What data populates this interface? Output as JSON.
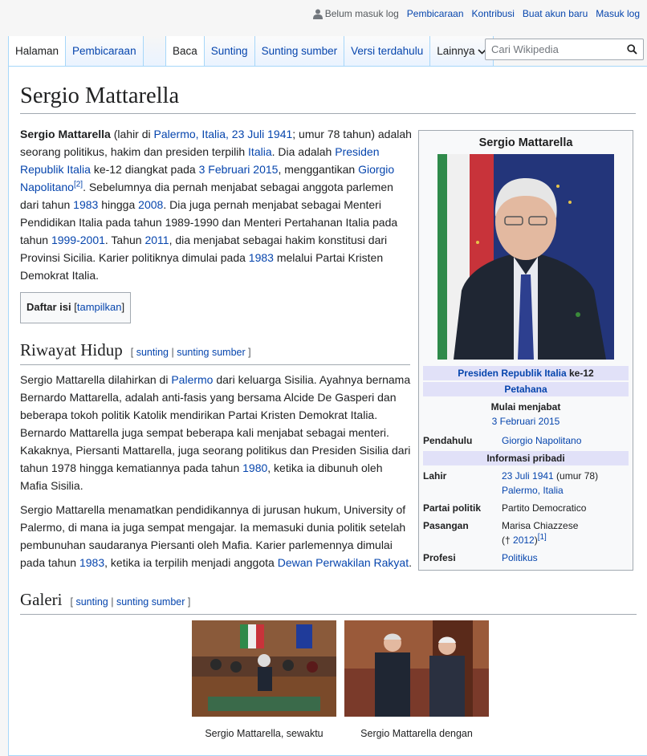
{
  "personal": {
    "anon": "Belum masuk log",
    "talk": "Pembicaraan",
    "contrib": "Kontribusi",
    "create": "Buat akun baru",
    "login": "Masuk log"
  },
  "tabs_left": [
    "Halaman",
    "Pembicaraan"
  ],
  "tabs_right": {
    "read": "Baca",
    "edit": "Sunting",
    "editsrc": "Sunting sumber",
    "history": "Versi terdahulu",
    "more": "Lainnya"
  },
  "search": {
    "placeholder": "Cari Wikipedia"
  },
  "title": "Sergio Mattarella",
  "intro": {
    "name": "Sergio Mattarella",
    "t1": " (lahir di ",
    "l_palermo": "Palermo, Italia, 23 Juli 1941",
    "t2": "; umur 78 tahun) adalah seorang politikus, hakim dan presiden terpilih ",
    "l_italia": "Italia",
    "t3": ". Dia adalah ",
    "l_presiden": "Presiden Republik Italia",
    "t4": " ke-12 diangkat pada ",
    "l_date": "3 Februari 2015",
    "t5": ", menggantikan ",
    "l_giorgio": "Giorgio Napolitano",
    "ref": "[2]",
    "t6": ". Sebelumnya dia pernah menjabat sebagai anggota parlemen dari tahun ",
    "l_1983": "1983",
    "t7": " hingga ",
    "l_2008": "2008",
    "t8": ". Dia juga pernah menjabat sebagai Menteri Pendidikan Italia pada tahun 1989-1990 dan Menteri Pertahanan Italia pada tahun ",
    "l_1999": "1999-2001",
    "t9": ". Tahun ",
    "l_2011": "2011",
    "t10": ", dia menjabat sebagai hakim konstitusi dari Provinsi Sicilia. Karier politiknya dimulai pada ",
    "l_1983b": "1983",
    "t11": " melalui Partai Kristen Demokrat Italia."
  },
  "toc": {
    "title": "Daftar isi",
    "open": " [",
    "show": "tampilkan",
    "close": "]"
  },
  "edit": {
    "open": "[ ",
    "sunting": "sunting",
    "sep": " | ",
    "sumber": "sunting sumber",
    "close": " ]"
  },
  "riwayat": {
    "heading": "Riwayat Hidup",
    "p1a": "Sergio Mattarella dilahirkan di ",
    "p1_palermo": "Palermo",
    "p1b": " dari keluarga Sisilia. Ayahnya bernama Bernardo Mattarella, adalah anti-fasis yang bersama Alcide De Gasperi dan beberapa tokoh politik Katolik mendirikan Partai Kristen Demokrat Italia. Bernardo Mattarella juga sempat beberapa kali menjabat sebagai menteri. Kakaknya, Piersanti Mattarella, juga seorang politikus dan Presiden Sisilia dari tahun 1978 hingga kematiannya pada tahun ",
    "p1_1980": "1980",
    "p1c": ", ketika ia dibunuh oleh Mafia Sisilia.",
    "p2a": "Sergio Mattarella menamatkan pendidikannya di jurusan hukum, University of Palermo, di mana ia juga sempat mengajar. Ia memasuki dunia politik setelah pembunuhan saudaranya Piersanti oleh Mafia. Karier parlemennya dimulai pada tahun ",
    "p2_1983": "1983",
    "p2b": ", ketika ia terpilih menjadi anggota ",
    "p2_dpr": "Dewan Perwakilan Rakyat",
    "p2c": "."
  },
  "galeri": {
    "heading": "Galeri",
    "cap1": "Sergio Mattarella, sewaktu",
    "cap2": "Sergio Mattarella dengan"
  },
  "infobox": {
    "title": "Sergio Mattarella",
    "office": "Presiden Republik Italia",
    "office_suffix": " ke-12",
    "incumbent": "Petahana",
    "start_label": "Mulai menjabat",
    "start_date": "3 Februari 2015",
    "pred_label": "Pendahulu",
    "pred": "Giorgio Napolitano",
    "personal_head": "Informasi pribadi",
    "born_label": "Lahir",
    "born_date": "23 Juli 1941",
    "born_age": " (umur 78)",
    "born_place": "Palermo, Italia",
    "party_label": "Partai politik",
    "party": "Partito Democratico",
    "spouse_label": "Pasangan",
    "spouse": "Marisa Chiazzese",
    "spouse_b": "(† ",
    "spouse_year": "2012",
    "spouse_c": ")",
    "spouse_ref": "[1]",
    "prof_label": "Profesi",
    "prof": "Politikus"
  },
  "colors": {
    "link": "#0645ad",
    "tab_border": "#a7d7f9",
    "infobox_header": "#e1e1f8"
  }
}
